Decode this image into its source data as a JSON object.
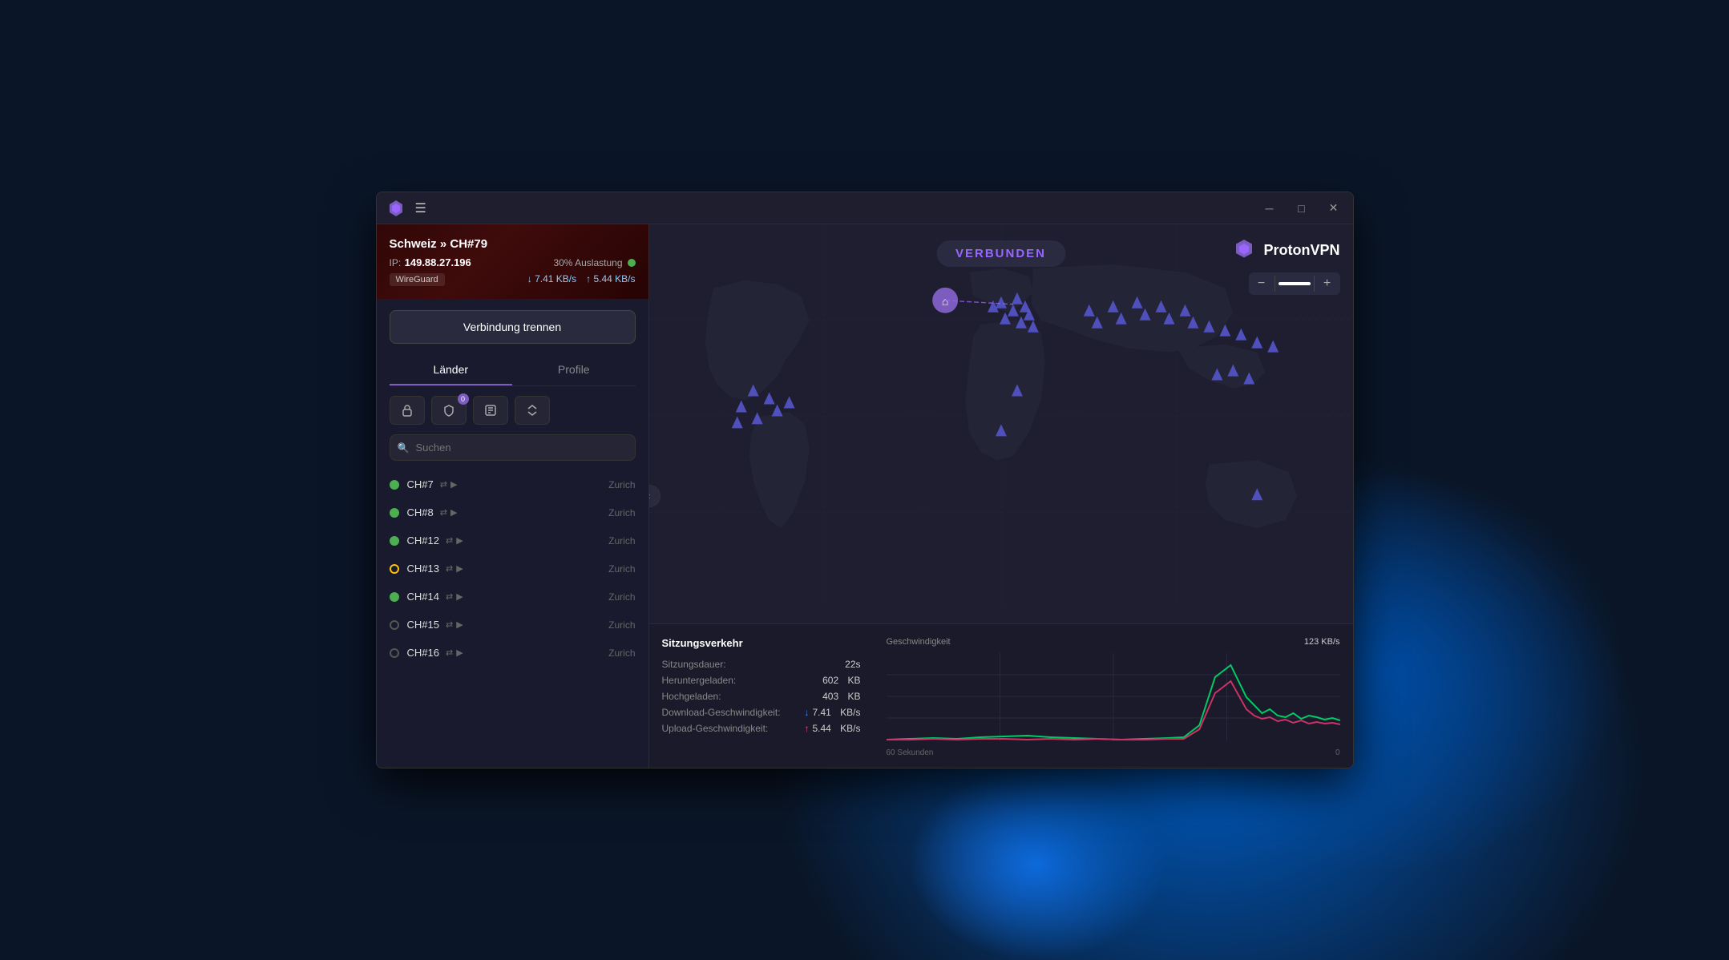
{
  "window": {
    "title": "ProtonVPN"
  },
  "titlebar": {
    "minimize_label": "─",
    "maximize_label": "□",
    "close_label": "✕",
    "hamburger": "☰"
  },
  "connection": {
    "server": "Schweiz » CH#79",
    "ip_label": "IP:",
    "ip": "149.88.27.196",
    "load_percent": "30% Auslastung",
    "protocol": "WireGuard",
    "download_speed": "↓ 7.41 KB/s",
    "upload_speed": "↑ 5.44 KB/s",
    "disconnect_btn": "Verbindung trennen",
    "status": "VERBUNDEN"
  },
  "tabs": {
    "countries_label": "Länder",
    "profiles_label": "Profile"
  },
  "filters": {
    "lock_icon": "🔒",
    "shield_icon": "🛡",
    "edit_icon": "📋",
    "arrow_icon": "⇄",
    "badge": "0"
  },
  "search": {
    "placeholder": "Suchen"
  },
  "servers": [
    {
      "name": "CH#7",
      "location": "Zurich",
      "status": "green"
    },
    {
      "name": "CH#8",
      "location": "Zurich",
      "status": "green"
    },
    {
      "name": "CH#12",
      "location": "Zurich",
      "status": "green"
    },
    {
      "name": "CH#13",
      "location": "Zurich",
      "status": "yellow"
    },
    {
      "name": "CH#14",
      "location": "Zurich",
      "status": "green"
    },
    {
      "name": "CH#15",
      "location": "Zurich",
      "status": "gray"
    },
    {
      "name": "CH#16",
      "location": "Zurich",
      "status": "gray"
    }
  ],
  "stats": {
    "section_title": "Sitzungsverkehr",
    "duration_label": "Sitzungsdauer:",
    "duration_value": "22s",
    "downloaded_label": "Heruntergeladen:",
    "downloaded_value": "602",
    "downloaded_unit": "KB",
    "uploaded_label": "Hochgeladen:",
    "uploaded_value": "403",
    "uploaded_unit": "KB",
    "download_speed_label": "Download-Geschwindigkeit:",
    "download_speed_value": "7.41",
    "download_speed_unit": "KB/s",
    "upload_speed_label": "Upload-Geschwindigkeit:",
    "upload_speed_value": "5.44",
    "upload_speed_unit": "KB/s"
  },
  "chart": {
    "label": "Geschwindigkeit",
    "max_value": "123 KB/s",
    "time_label": "60 Sekunden",
    "time_end": "0"
  },
  "brand": {
    "name": "ProtonVPN"
  },
  "zoom": {
    "minus": "−",
    "plus": "+"
  },
  "map_markers": [
    {
      "x": 22,
      "y": 45
    },
    {
      "x": 24,
      "y": 42
    },
    {
      "x": 26,
      "y": 44
    },
    {
      "x": 28,
      "y": 40
    },
    {
      "x": 30,
      "y": 43
    },
    {
      "x": 32,
      "y": 41
    },
    {
      "x": 34,
      "y": 39
    },
    {
      "x": 36,
      "y": 42
    },
    {
      "x": 38,
      "y": 44
    },
    {
      "x": 40,
      "y": 40
    },
    {
      "x": 42,
      "y": 38
    },
    {
      "x": 44,
      "y": 41
    },
    {
      "x": 46,
      "y": 43
    },
    {
      "x": 48,
      "y": 40
    },
    {
      "x": 50,
      "y": 38
    },
    {
      "x": 52,
      "y": 42
    },
    {
      "x": 54,
      "y": 44
    },
    {
      "x": 56,
      "y": 41
    },
    {
      "x": 58,
      "y": 39
    },
    {
      "x": 60,
      "y": 43
    },
    {
      "x": 62,
      "y": 41
    },
    {
      "x": 64,
      "y": 38
    },
    {
      "x": 66,
      "y": 42
    },
    {
      "x": 68,
      "y": 45
    },
    {
      "x": 70,
      "y": 40
    },
    {
      "x": 72,
      "y": 43
    },
    {
      "x": 74,
      "y": 41
    },
    {
      "x": 76,
      "y": 38
    },
    {
      "x": 78,
      "y": 44
    },
    {
      "x": 80,
      "y": 42
    },
    {
      "x": 18,
      "y": 50
    },
    {
      "x": 20,
      "y": 52
    },
    {
      "x": 22,
      "y": 55
    },
    {
      "x": 24,
      "y": 58
    },
    {
      "x": 26,
      "y": 55
    },
    {
      "x": 16,
      "y": 48
    },
    {
      "x": 42,
      "y": 55
    },
    {
      "x": 44,
      "y": 58
    },
    {
      "x": 46,
      "y": 55
    },
    {
      "x": 60,
      "y": 48
    },
    {
      "x": 62,
      "y": 52
    },
    {
      "x": 64,
      "y": 55
    },
    {
      "x": 66,
      "y": 50
    },
    {
      "x": 68,
      "y": 53
    },
    {
      "x": 70,
      "y": 56
    },
    {
      "x": 72,
      "y": 50
    },
    {
      "x": 74,
      "y": 53
    },
    {
      "x": 76,
      "y": 56
    },
    {
      "x": 82,
      "y": 42
    },
    {
      "x": 84,
      "y": 44
    },
    {
      "x": 86,
      "y": 42
    },
    {
      "x": 88,
      "y": 55
    },
    {
      "x": 50,
      "y": 62
    },
    {
      "x": 52,
      "y": 65
    }
  ]
}
